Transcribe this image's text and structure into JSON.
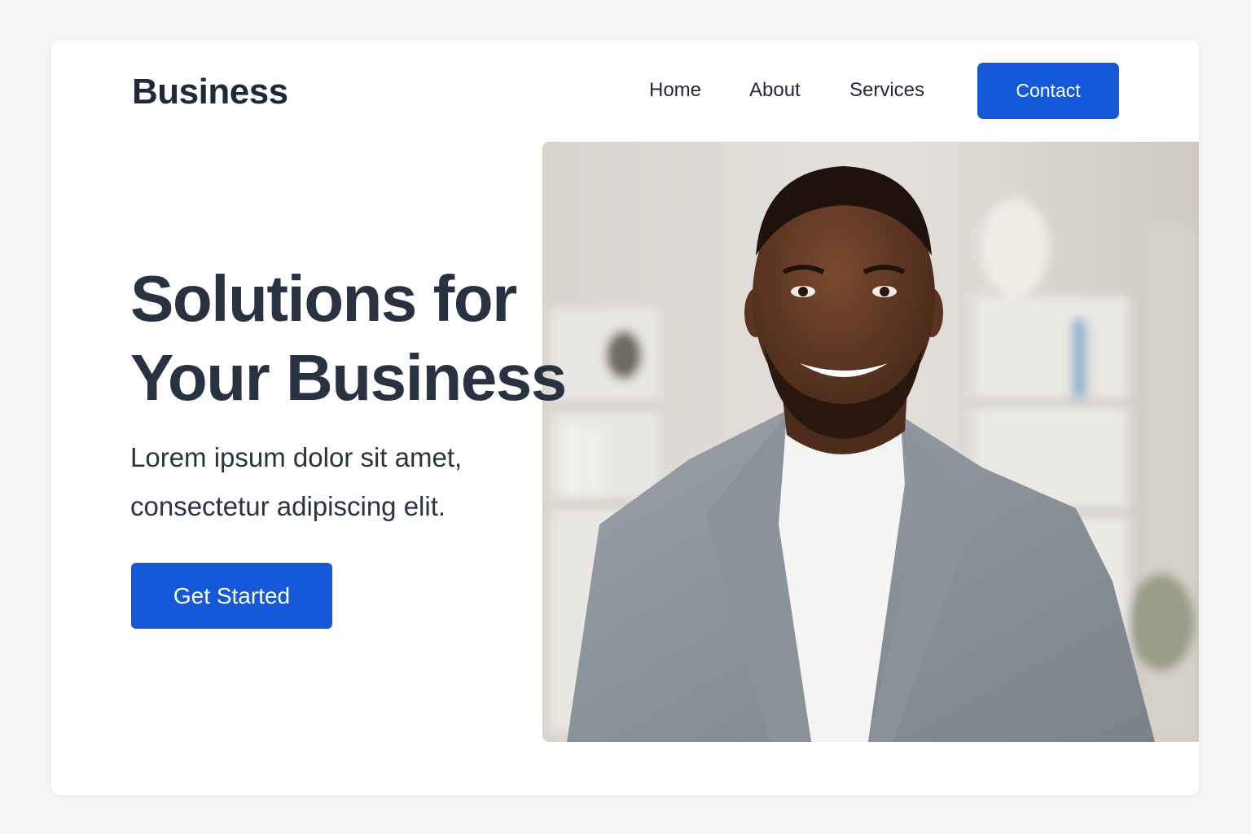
{
  "brand": {
    "name": "Business"
  },
  "nav": {
    "items": [
      {
        "label": "Home"
      },
      {
        "label": "About"
      },
      {
        "label": "Services"
      }
    ],
    "contact_label": "Contact"
  },
  "hero": {
    "title_line1": "Solutions for",
    "title_line2": "Your Business",
    "subtitle_line1": "Lorem ipsum dolor sit amet,",
    "subtitle_line2": "consectetur adipiscing elit.",
    "cta_label": "Get Started",
    "image_subject": "smiling man in grey blazer"
  },
  "colors": {
    "accent": "#1559d8",
    "heading": "#283241",
    "text": "#1f2937",
    "page_background": "#f7f7f8",
    "card_background": "#ffffff"
  }
}
